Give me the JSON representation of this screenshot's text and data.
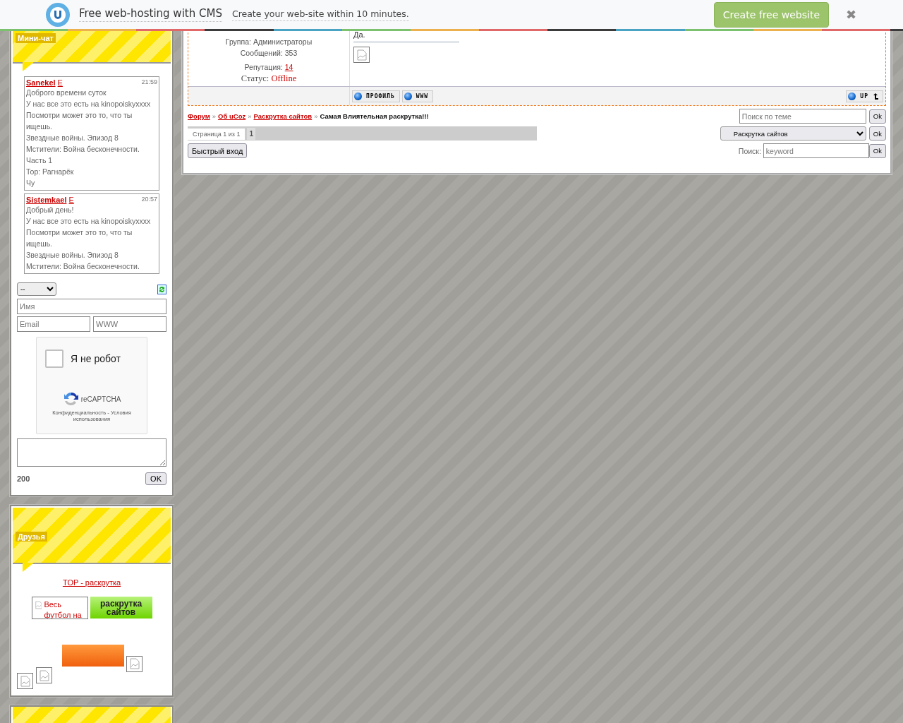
{
  "top_bar": {
    "title": "Free web-hosting with CMS",
    "tagline": "Create your web-site within 10 minutes.",
    "cta": "Create free website",
    "close": "✖"
  },
  "mini_chat": {
    "title": "Мини-чат",
    "messages": [
      {
        "author": "Sanekel",
        "flag": "E",
        "time": "21:59",
        "lines": [
          "Доброго времени суток",
          "У нас все это есть на kinopoiskyxxxx",
          "Посмотри может это то, что ты ищешь.",
          "Звездные войны. Эпизод 8",
          "Мстители: Война бесконечности.",
          "Часть 1",
          "Тор: Рагнарёк",
          "Чу"
        ]
      },
      {
        "author": "Sistemkael",
        "flag": "E",
        "time": "20:57",
        "lines": [
          "Добрый день!",
          "У нас все это есть на kinopoiskyxxxx",
          "Посмотри может это то, что ты ищешь.",
          "Звездные войны. Эпизод 8",
          "Мстители: Война бесконечности."
        ]
      }
    ],
    "select": "--",
    "name_placeholder": "Имя",
    "email_placeholder": "Email",
    "www_placeholder": "WWW",
    "captcha": {
      "label": "Я не робот",
      "checked": false,
      "brand": "reCAPTCHA",
      "links": "Конфиденциальность - Условия использования"
    },
    "counter": "200",
    "submit": "OK"
  },
  "friends": {
    "title": "Друзья",
    "link": "TOP - раскрутка",
    "banners": [
      {
        "kind": "alt",
        "text": "Весь футбол на"
      },
      {
        "kind": "green",
        "text": "раскрутка сайтов"
      },
      {
        "kind": "orange"
      },
      {
        "kind": "broken"
      },
      {
        "kind": "broken"
      },
      {
        "kind": "broken"
      }
    ]
  },
  "post": {
    "group": "Группа: Администраторы",
    "posts": "Сообщений: 353",
    "reputation_label": "Репутация:",
    "reputation": "14",
    "status_label": "Статус:",
    "status": "Offline",
    "message": "Да.",
    "buttons": [
      "ПРОФИЛЬ",
      "WWW"
    ],
    "up": "UP"
  },
  "breadcrumbs": [
    {
      "text": "Форум",
      "link": true
    },
    {
      "text": "Об uCoz",
      "link": true
    },
    {
      "text": "Раскрутка сайтов",
      "link": true
    },
    {
      "text": "Самая Влиятельная раскрутка!!!",
      "link": false
    }
  ],
  "separator": "»",
  "topic_search": {
    "placeholder": "Поиск по теме",
    "button": "Ok"
  },
  "pagination": {
    "label": "Страница 1 из 1",
    "pages": [
      {
        "label": "1",
        "selected": true
      }
    ]
  },
  "forum_select": {
    "value": "Раскрутка сайтов",
    "button": "Ok"
  },
  "quick_login": "Быстрый вход",
  "search": {
    "label": "Поиск:",
    "placeholder": "keyword",
    "button": "Ok"
  }
}
